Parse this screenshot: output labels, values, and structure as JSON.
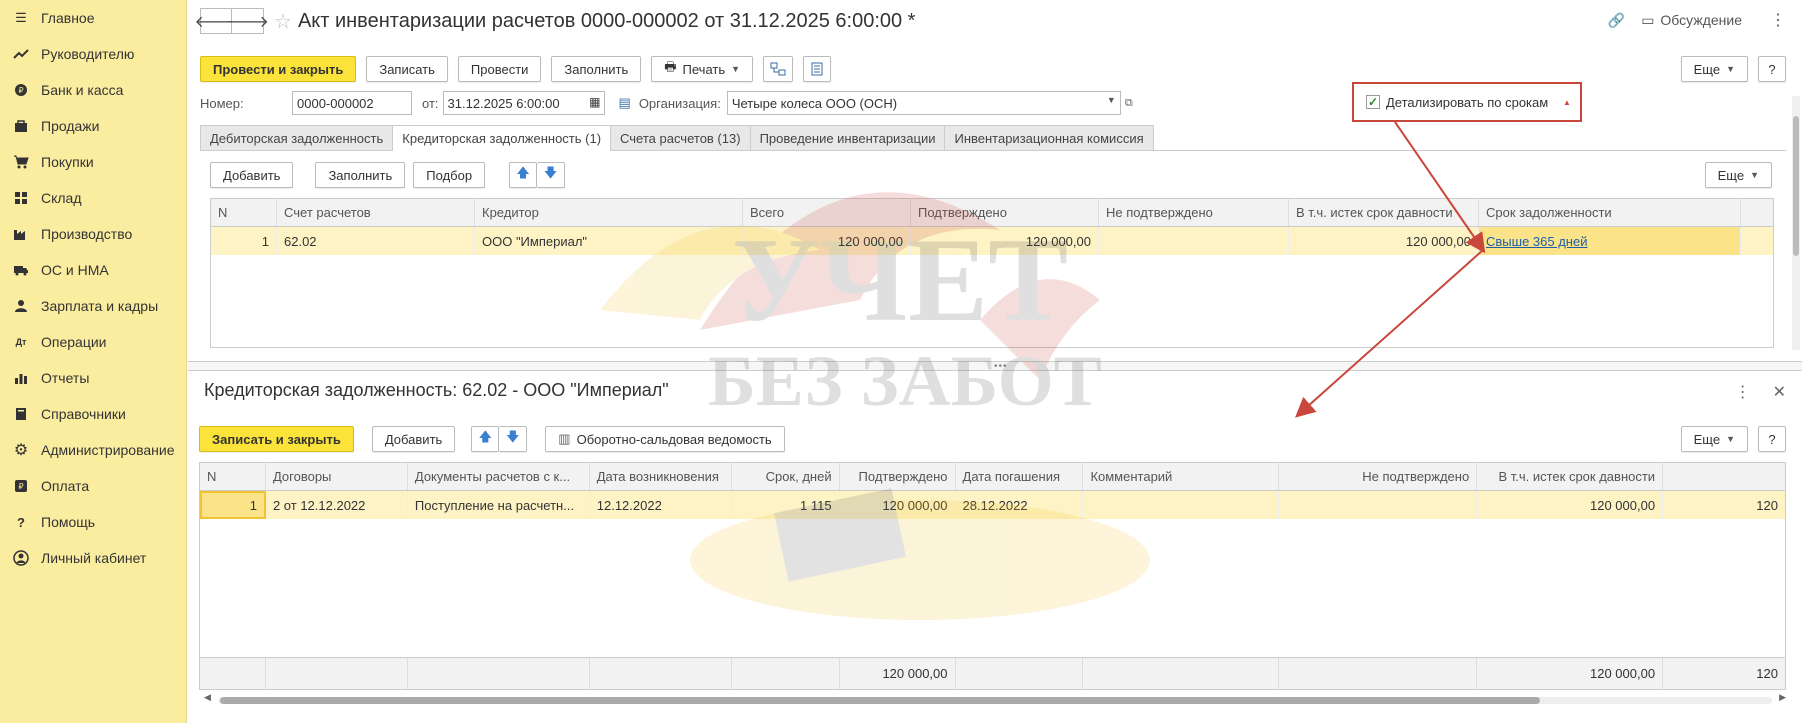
{
  "sidebar": {
    "items": [
      {
        "label": "Главное",
        "icon": "menu-icon"
      },
      {
        "label": "Руководителю",
        "icon": "trend-icon"
      },
      {
        "label": "Банк и касса",
        "icon": "coin-icon"
      },
      {
        "label": "Продажи",
        "icon": "bag-icon"
      },
      {
        "label": "Покупки",
        "icon": "cart-icon"
      },
      {
        "label": "Склад",
        "icon": "warehouse-icon"
      },
      {
        "label": "Производство",
        "icon": "factory-icon"
      },
      {
        "label": "ОС и НМА",
        "icon": "truck-icon"
      },
      {
        "label": "Зарплата и кадры",
        "icon": "person-icon"
      },
      {
        "label": "Операции",
        "icon": "operations-icon"
      },
      {
        "label": "Отчеты",
        "icon": "bar-chart-icon"
      },
      {
        "label": "Справочники",
        "icon": "book-icon"
      },
      {
        "label": "Администрирование",
        "icon": "gear-icon"
      },
      {
        "label": "Оплата",
        "icon": "payment-icon"
      },
      {
        "label": "Помощь",
        "icon": "question-icon"
      },
      {
        "label": "Личный кабинет",
        "icon": "user-circle-icon"
      }
    ]
  },
  "header": {
    "title": "Акт инвентаризации расчетов 0000-000002 от 31.12.2025 6:00:00 *",
    "discussion_label": "Обсуждение"
  },
  "toolbar": {
    "post_close": "Провести и закрыть",
    "save": "Записать",
    "post": "Провести",
    "fill": "Заполнить",
    "print": "Печать",
    "more": "Еще"
  },
  "fields": {
    "number_label": "Номер:",
    "number_value": "0000-000002",
    "date_label": "от:",
    "date_value": "31.12.2025  6:00:00",
    "org_label": "Организация:",
    "org_value": "Четыре колеса ООО (ОСН)",
    "detail_label": "Детализировать по срокам",
    "detail_checked": true
  },
  "tabs": [
    {
      "label": "Дебиторская задолженность",
      "active": false
    },
    {
      "label": "Кредиторская задолженность (1)",
      "active": true
    },
    {
      "label": "Счета расчетов (13)",
      "active": false
    },
    {
      "label": "Проведение инвентаризации",
      "active": false
    },
    {
      "label": "Инвентаризационная комиссия",
      "active": false
    }
  ],
  "tab_toolbar": {
    "add": "Добавить",
    "fill": "Заполнить",
    "pick": "Подбор",
    "more": "Еще"
  },
  "table1": {
    "headers": [
      "N",
      "Счет расчетов",
      "Кредитор",
      "Всего",
      "Подтверждено",
      "Не подтверждено",
      "В т.ч. истек срок давности",
      "Срок задолженности"
    ],
    "rows": [
      {
        "n": "1",
        "account": "62.02",
        "creditor": "ООО \"Империал\"",
        "total": "120 000,00",
        "confirmed": "120 000,00",
        "unconfirmed": "",
        "expired": "120 000,00",
        "term": "Свыше 365 дней"
      }
    ]
  },
  "subform": {
    "title": "Кредиторская задолженность: 62.02 - ООО \"Империал\"",
    "save_close": "Записать и закрыть",
    "add": "Добавить",
    "turnover": "Оборотно-сальдовая ведомость",
    "more": "Еще",
    "help": "?"
  },
  "table2": {
    "headers": [
      "N",
      "Договоры",
      "Документы расчетов с к...",
      "Дата возникновения",
      "Срок, дней",
      "Подтверждено",
      "Дата погашения",
      "Комментарий",
      "Не подтверждено",
      "В т.ч. истек срок давности",
      ""
    ],
    "rows": [
      {
        "n": "1",
        "contract": "2 от 12.12.2022",
        "document": "Поступление на расчетн...",
        "date_start": "12.12.2022",
        "days": "1 115",
        "confirmed": "120 000,00",
        "date_end": "28.12.2022",
        "comment": "",
        "unconfirmed": "",
        "expired": "120 000,00",
        "extra": "120"
      }
    ],
    "totals": {
      "confirmed": "120 000,00",
      "expired": "120 000,00",
      "extra": "120"
    }
  },
  "watermark": {
    "line1": "УЧЕТ",
    "line2": "БЕЗ ЗАБОТ"
  },
  "colors": {
    "sidebar_bg": "#fbeda0",
    "primary_button": "#fbe33a",
    "selected_row": "#fdf3c5",
    "annotation": "#c9463b",
    "link": "#1e5fa8"
  }
}
